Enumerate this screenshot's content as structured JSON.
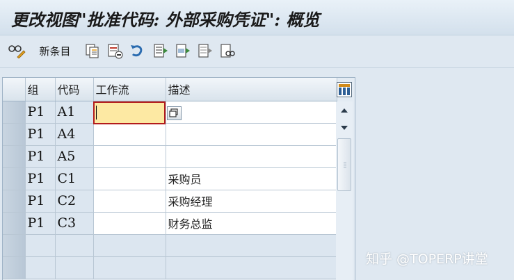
{
  "window": {
    "title": "更改视图\"批准代码: 外部采购凭证\": 概览"
  },
  "toolbar": {
    "display_change_icon": "glasses-pencil-icon",
    "new_entries_label": "新条目",
    "copy_as_icon": "copy-as-icon",
    "delete_icon": "delete-icon",
    "undo_icon": "undo-change-icon",
    "select_all_icon": "select-all-icon",
    "select_block_icon": "select-block-icon",
    "deselect_all_icon": "deselect-all-icon",
    "print_icon": "print-preview-icon"
  },
  "table": {
    "columns": [
      "组",
      "代码",
      "工作流",
      "描述"
    ],
    "rows": [
      {
        "group": "P1",
        "code": "A1",
        "workflow": "",
        "description": ""
      },
      {
        "group": "P1",
        "code": "A4",
        "workflow": "",
        "description": ""
      },
      {
        "group": "P1",
        "code": "A5",
        "workflow": "",
        "description": ""
      },
      {
        "group": "P1",
        "code": "C1",
        "workflow": "",
        "description": "采购员"
      },
      {
        "group": "P1",
        "code": "C2",
        "workflow": "",
        "description": "采购经理"
      },
      {
        "group": "P1",
        "code": "C3",
        "workflow": "",
        "description": "财务总监"
      }
    ],
    "empty_rows": 2
  },
  "watermark": "知乎 @TOPERP讲堂",
  "colors": {
    "focus_cell_bg": "#fde9a3",
    "focus_border": "#b31b1b",
    "key_cell_bg": "#dce6f0",
    "background": "#dfe8f1"
  }
}
